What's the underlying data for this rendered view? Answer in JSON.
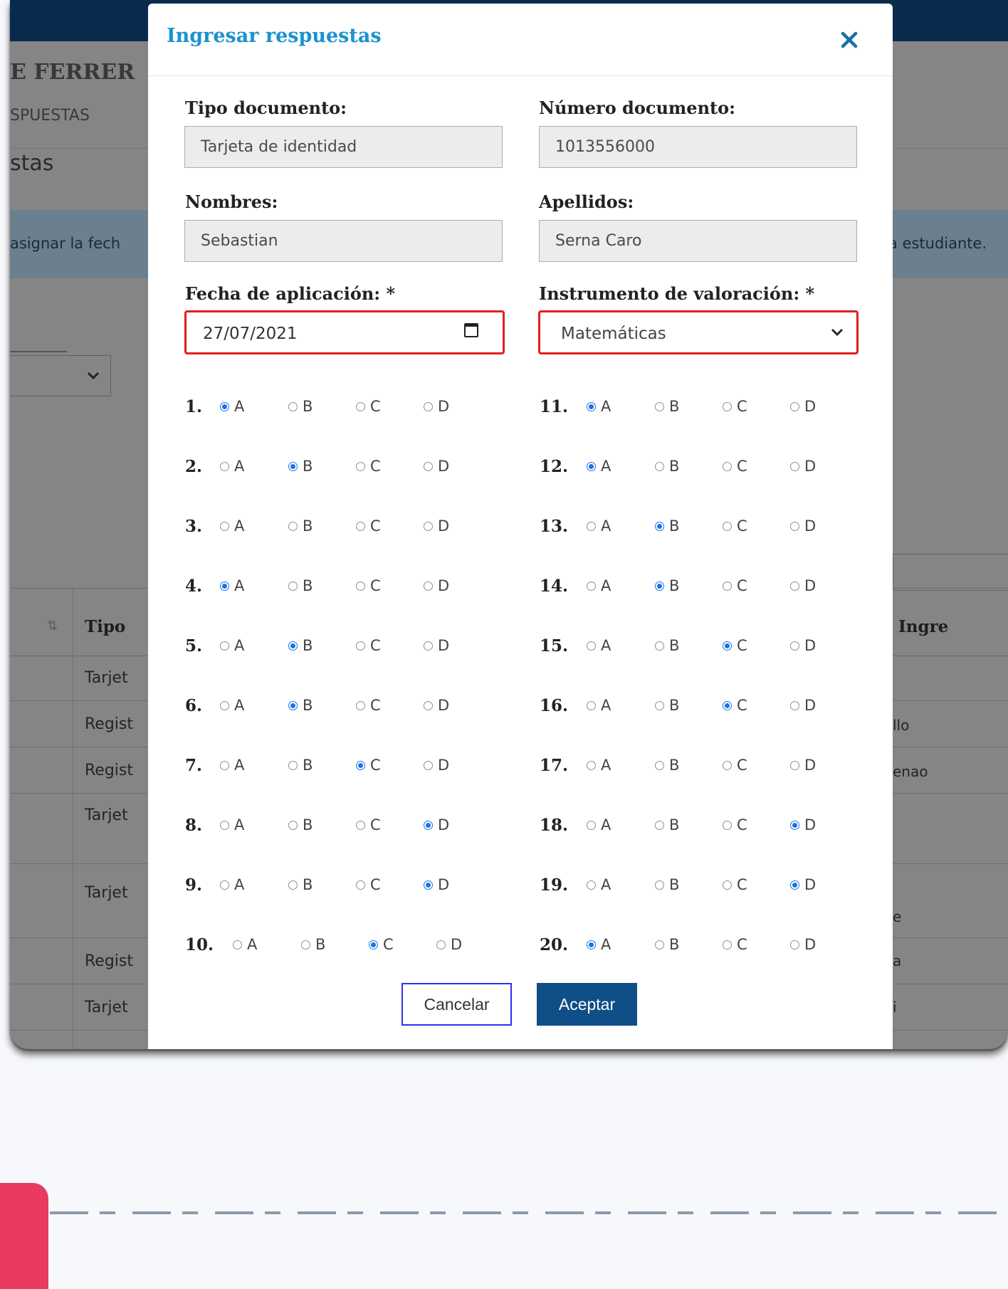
{
  "background": {
    "school_name": "E FERRER",
    "breadcrumb": "SPUESTAS",
    "page_title": "stas",
    "alert_left": "asignar la fech",
    "alert_right": "a estudiante.",
    "table": {
      "header_left": "Tipo",
      "header_right": "Ingre",
      "rows": [
        {
          "type": "Tarjet",
          "right": ""
        },
        {
          "type": "Regist",
          "right": "llo"
        },
        {
          "type": "Regist",
          "right": "enao"
        },
        {
          "type": "Tarjet",
          "right": ""
        },
        {
          "type": "Tarjet",
          "right": "e"
        },
        {
          "type": "Regist",
          "right": "a"
        },
        {
          "type": "Tarjet",
          "right": "i"
        }
      ]
    }
  },
  "modal": {
    "title": "Ingresar respuestas",
    "close_icon": "close-icon",
    "tipo_documento": {
      "label": "Tipo documento:",
      "value": "Tarjeta de identidad"
    },
    "numero_documento": {
      "label": "Número documento:",
      "value": "1013556000"
    },
    "nombres": {
      "label": "Nombres:",
      "value": "Sebastian"
    },
    "apellidos": {
      "label": "Apellidos:",
      "value": "Serna Caro"
    },
    "fecha": {
      "label": "Fecha de aplicación: *",
      "value": "27/07/2021",
      "icon": "calendar-icon"
    },
    "instrumento": {
      "label": "Instrumento de valoración: *",
      "value": "Matemáticas",
      "icon": "chevron-down-icon"
    },
    "highlight_color": "#e41d22",
    "radio_color": "#1a73e8",
    "options": [
      "A",
      "B",
      "C",
      "D"
    ],
    "questions": [
      {
        "num": "1.",
        "answer": "A"
      },
      {
        "num": "2.",
        "answer": "B"
      },
      {
        "num": "3.",
        "answer": ""
      },
      {
        "num": "4.",
        "answer": "A"
      },
      {
        "num": "5.",
        "answer": "B"
      },
      {
        "num": "6.",
        "answer": "B"
      },
      {
        "num": "7.",
        "answer": "C"
      },
      {
        "num": "8.",
        "answer": "D"
      },
      {
        "num": "9.",
        "answer": "D"
      },
      {
        "num": "10.",
        "answer": "C"
      },
      {
        "num": "11.",
        "answer": "A"
      },
      {
        "num": "12.",
        "answer": "A"
      },
      {
        "num": "13.",
        "answer": "B"
      },
      {
        "num": "14.",
        "answer": "B"
      },
      {
        "num": "15.",
        "answer": "C"
      },
      {
        "num": "16.",
        "answer": "C"
      },
      {
        "num": "17.",
        "answer": ""
      },
      {
        "num": "18.",
        "answer": "D"
      },
      {
        "num": "19.",
        "answer": "D"
      },
      {
        "num": "20.",
        "answer": "A"
      }
    ],
    "cancel_label": "Cancelar",
    "accept_label": "Aceptar",
    "accept_color": "#0f4e86"
  }
}
